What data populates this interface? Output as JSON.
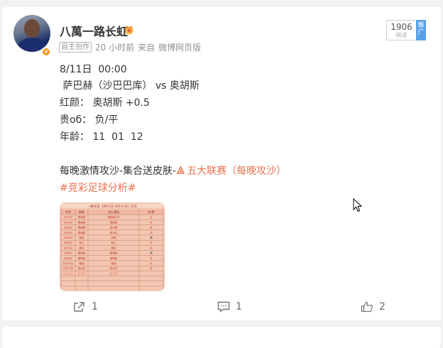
{
  "post": {
    "author": {
      "name": "八萬一路长虹",
      "badge_icon": "crown-icon",
      "verified_icon": "v-badge-icon"
    },
    "meta": {
      "tag": "自主创作",
      "time": "20 小时前",
      "source_label": "来自",
      "source": "微博网页版"
    },
    "promo": {
      "count": "1906",
      "sub": "阅读",
      "tag": "推广"
    },
    "content": {
      "line1": "8/11日  00:00",
      "line2": " 萨巴赫（沙巴巴库） vs 奥胡斯",
      "line3": "红颜： 奥胡斯 +0.5",
      "line4": "贵об： 负/平",
      "line5": "年龄： 11  01  12",
      "line6_prefix": "每晚激情攻沙-集合送皮肤-",
      "line6_link": "五大联赛（每晚攻沙）",
      "hashtag": "#竞彩足球分析#"
    },
    "image": {
      "title": "一路长虹【8月1日-8月31日】纪实",
      "headers": [
        "时间",
        "联赛",
        "主队/客队",
        "红/黑"
      ],
      "rows": [
        [
          "8月1日",
          "挪威超",
          "挪威超1对",
          "红"
        ],
        [
          "8月2日",
          "挪威超",
          "挪威超",
          "红"
        ],
        [
          "8月3日",
          "挪威超",
          "莫尔德",
          "红"
        ],
        [
          "8月4日",
          "挪威超",
          "哈马坎",
          "红"
        ],
        [
          "8月5日",
          "瑞超",
          "赫根",
          "黑"
        ],
        [
          "8月6日",
          "荷乙",
          "荷乙",
          "红"
        ],
        [
          "8月7日",
          "美职",
          "美职",
          "红"
        ],
        [
          "8月8日",
          "挪威超",
          "挪威超",
          "黑"
        ],
        [
          "8月9日",
          "挪威超",
          "挪威超",
          "红"
        ],
        [
          "8月10日",
          "葡超",
          "葡超",
          "红"
        ],
        [
          "8月10日",
          "欧会杯",
          "欧会杯",
          "红"
        ],
        [
          "8月11日",
          "欧会杯",
          "欧会杯",
          ""
        ]
      ]
    },
    "actions": {
      "share_count": "1",
      "comment_count": "1",
      "like_count": "2"
    }
  }
}
